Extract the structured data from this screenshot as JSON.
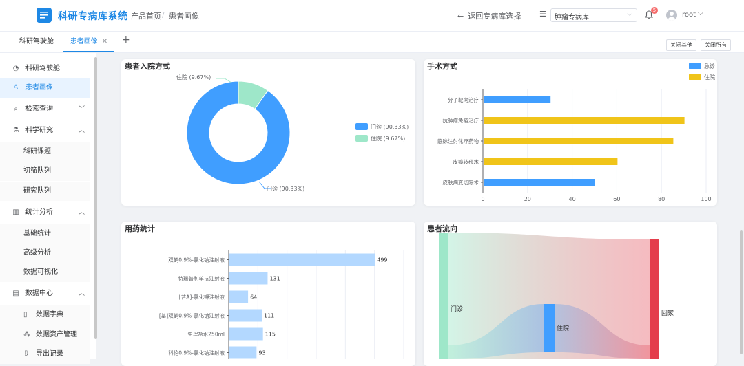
{
  "app": {
    "title": "科研专病库系统",
    "logo_icon": "document-list-icon"
  },
  "breadcrumb": {
    "home": "产品首页",
    "sep": "/",
    "current": "患者画像"
  },
  "header": {
    "back_label": "返回专病库选择",
    "db_select_value": "肿瘤专病库",
    "notification_count": "5",
    "username": "root"
  },
  "tabs": [
    {
      "label": "科研驾驶舱"
    },
    {
      "label": "患者画像"
    }
  ],
  "tab_actions": {
    "close_others": "关闭其他",
    "close_all": "关闭所有"
  },
  "sidebar": {
    "items": [
      {
        "label": "科研驾驶舱",
        "icon": "dashboard-icon"
      },
      {
        "label": "患者画像",
        "icon": "user-icon"
      },
      {
        "label": "检索查询",
        "icon": "search-icon",
        "chevron": "﹀"
      },
      {
        "label": "科学研究",
        "icon": "flask-icon",
        "chevron": "︿"
      },
      {
        "label": "统计分析",
        "icon": "bar-chart-icon",
        "chevron": "︿"
      },
      {
        "label": "数据中心",
        "icon": "database-icon",
        "chevron": "︿"
      }
    ],
    "science_sub": [
      "科研课题",
      "初筛队列",
      "研究队列"
    ],
    "stats_sub": [
      "基础统计",
      "高级分析",
      "数据可视化"
    ],
    "data_sub": [
      {
        "label": "数据字典",
        "icon": "book-icon"
      },
      {
        "label": "数据资产管理",
        "icon": "assets-icon"
      },
      {
        "label": "导出记录",
        "icon": "export-icon"
      }
    ]
  },
  "colors": {
    "blue": "#409eff",
    "green": "#9ee7c9",
    "yellow": "#f0c419",
    "light_blue": "#b3d8ff",
    "red": "#e43d4c",
    "accent": "#1e88e5"
  },
  "charts": {
    "admission": {
      "title": "患者入院方式"
    },
    "surgery": {
      "title": "手术方式"
    },
    "medication": {
      "title": "用药统计"
    },
    "flow": {
      "title": "患者流向"
    }
  },
  "chart_data": [
    {
      "type": "pie",
      "title": "患者入院方式",
      "donut": true,
      "legend_position": "right",
      "slices": [
        {
          "name": "门诊",
          "value": 90.33,
          "label": "门诊 (90.33%)",
          "color": "#409eff"
        },
        {
          "name": "住院",
          "value": 9.67,
          "label": "住院 (9.67%)",
          "color": "#9ee7c9"
        }
      ]
    },
    {
      "type": "bar",
      "orientation": "horizontal",
      "title": "手术方式",
      "legend_position": "top-right",
      "categories": [
        "分子靶向治疗",
        "抗肿瘤免疫治疗",
        "静脉注射化疗药物",
        "皮瓣转移术",
        "皮肤病变切除术"
      ],
      "series": [
        {
          "name": "急诊",
          "color": "#409eff",
          "values": [
            30,
            null,
            null,
            null,
            50
          ]
        },
        {
          "name": "住院",
          "color": "#f0c419",
          "values": [
            null,
            90,
            85,
            60,
            null
          ]
        }
      ],
      "xlim": [
        0,
        100
      ],
      "xticks": [
        0,
        20,
        40,
        60,
        80,
        100
      ],
      "grid": true
    },
    {
      "type": "bar",
      "orientation": "horizontal",
      "title": "用药统计",
      "categories": [
        "双鹤0.9%-氯化钠注射液",
        "特瑞普利单抗注射液",
        "[苔A]-氯化钾注射液",
        "[基]双鹤0.9%-氯化钠注射液",
        "生理盐水250ml",
        "科伦0.9%-氯化钠注射液"
      ],
      "values": [
        499,
        131,
        64,
        111,
        115,
        93
      ],
      "data_labels": true,
      "grid": true
    },
    {
      "type": "sankey",
      "title": "患者流向",
      "nodes": [
        {
          "name": "门诊",
          "color": "#9ee7c9"
        },
        {
          "name": "住院",
          "color": "#409eff"
        },
        {
          "name": "回家",
          "color": "#e43d4c"
        }
      ]
    }
  ]
}
